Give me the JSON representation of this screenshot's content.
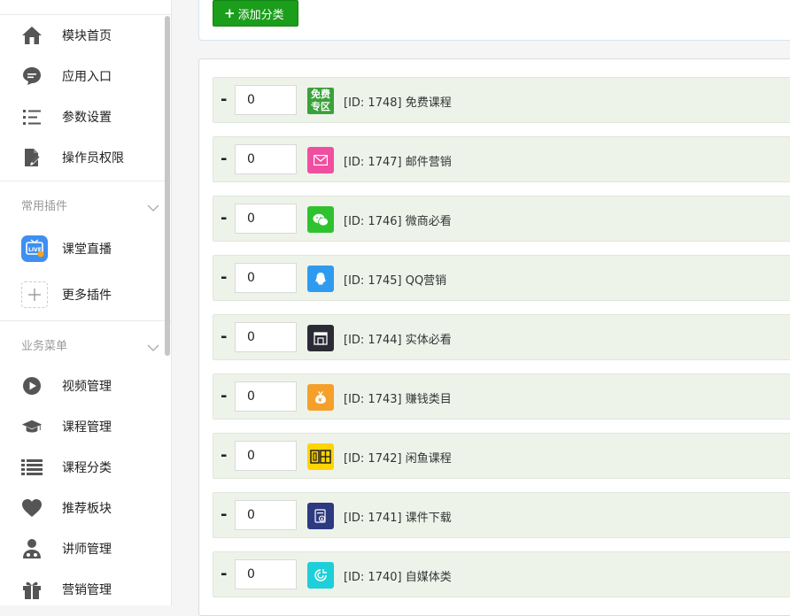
{
  "sidebar": {
    "items": [
      {
        "label": "模块首页",
        "icon": "home-icon"
      },
      {
        "label": "应用入口",
        "icon": "chat-bubble-icon"
      },
      {
        "label": "参数设置",
        "icon": "settings-list-icon"
      },
      {
        "label": "操作员权限",
        "icon": "edit-document-icon"
      }
    ],
    "groups": [
      {
        "label": "常用插件",
        "items": [
          {
            "label": "课堂直播",
            "icon": "live-tv-icon"
          },
          {
            "label": "更多插件",
            "icon": "plus-box-icon"
          }
        ]
      },
      {
        "label": "业务菜单",
        "items": [
          {
            "label": "视频管理",
            "icon": "play-circle-icon"
          },
          {
            "label": "课程管理",
            "icon": "graduation-cap-icon"
          },
          {
            "label": "课程分类",
            "icon": "list-icon"
          },
          {
            "label": "推荐板块",
            "icon": "heart-icon"
          },
          {
            "label": "讲师管理",
            "icon": "teacher-icon"
          },
          {
            "label": "营销管理",
            "icon": "gift-icon"
          }
        ]
      }
    ]
  },
  "toolbar": {
    "add_label": "添加分类"
  },
  "categories": [
    {
      "sort": "0",
      "label": "[ID: 1748] 免费课程",
      "icon": "free-zone-icon",
      "icon_text_1": "免费",
      "icon_text_2": "专区",
      "color": "#3aa23a"
    },
    {
      "sort": "0",
      "label": "[ID: 1747] 邮件营销",
      "icon": "envelope-icon",
      "color": "#f04fa0"
    },
    {
      "sort": "0",
      "label": "[ID: 1746] 微商必看",
      "icon": "wechat-icon",
      "color": "#2fc22f"
    },
    {
      "sort": "0",
      "label": "[ID: 1745] QQ营销",
      "icon": "qq-icon",
      "color": "#2e9bf0"
    },
    {
      "sort": "0",
      "label": "[ID: 1744] 实体必看",
      "icon": "store-icon",
      "color": "#2b2b36"
    },
    {
      "sort": "0",
      "label": "[ID: 1743] 赚钱类目",
      "icon": "money-bag-icon",
      "color": "#f5a02a"
    },
    {
      "sort": "0",
      "label": "[ID: 1742] 闲鱼课程",
      "icon": "xianyu-icon",
      "color": "#ffd400"
    },
    {
      "sort": "0",
      "label": "[ID: 1741] 课件下载",
      "icon": "download-doc-icon",
      "color": "#2d3a80"
    },
    {
      "sort": "0",
      "label": "[ID: 1740] 自媒体类",
      "icon": "media-icon",
      "color": "#1ccfd8"
    }
  ]
}
